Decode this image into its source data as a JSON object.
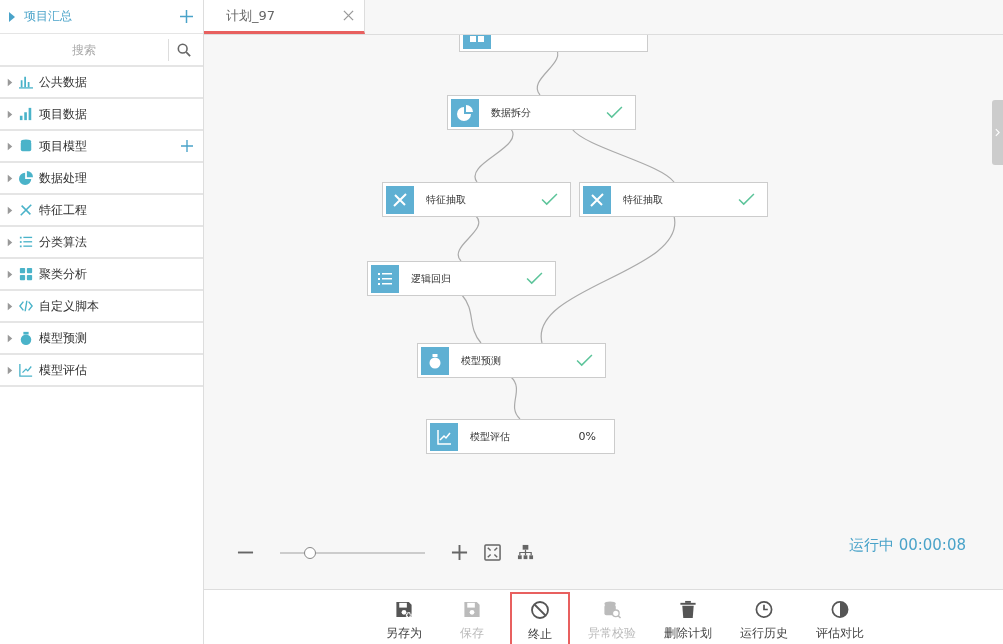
{
  "sidebar": {
    "header": {
      "label": "项目汇总",
      "expanded": false
    },
    "search": {
      "placeholder": "搜索"
    },
    "items": [
      {
        "label": "公共数据",
        "kind": "bars",
        "addable": false
      },
      {
        "label": "项目数据",
        "kind": "signal",
        "addable": false
      },
      {
        "label": "项目模型",
        "kind": "database",
        "addable": true
      },
      {
        "label": "数据处理",
        "kind": "pie",
        "addable": false
      },
      {
        "label": "特征工程",
        "kind": "tools",
        "addable": false
      },
      {
        "label": "分类算法",
        "kind": "list",
        "addable": false
      },
      {
        "label": "聚类分析",
        "kind": "grid",
        "addable": false
      },
      {
        "label": "自定义脚本",
        "kind": "code",
        "addable": false
      },
      {
        "label": "模型预测",
        "kind": "flask",
        "addable": false
      },
      {
        "label": "模型评估",
        "kind": "chart",
        "addable": false
      }
    ]
  },
  "tabs": [
    {
      "label": "计划_97",
      "selected": true
    }
  ],
  "flow": {
    "nodes": [
      {
        "kind": "grid"
      },
      {
        "label": "数据拆分",
        "kind": "pie",
        "done": true
      },
      {
        "label": "特征抽取",
        "kind": "tools",
        "done": true
      },
      {
        "label": "特征抽取",
        "kind": "tools",
        "done": true
      },
      {
        "label": "逻辑回归",
        "kind": "list",
        "done": true
      },
      {
        "label": "模型预测",
        "kind": "flask",
        "done": true
      },
      {
        "label": "模型评估",
        "kind": "chart",
        "done": false,
        "progress": "0%"
      }
    ],
    "zoom": {
      "level": 0.19
    },
    "run_status": "运行中 00:00:08"
  },
  "toolbar": [
    {
      "label": "另存为",
      "kind": "saveas",
      "disabled": false,
      "highlighted": false
    },
    {
      "label": "保存",
      "kind": "save",
      "disabled": true,
      "highlighted": false
    },
    {
      "label": "终止",
      "kind": "stop",
      "disabled": false,
      "highlighted": true
    },
    {
      "label": "异常校验",
      "kind": "check",
      "disabled": true,
      "highlighted": false
    },
    {
      "label": "删除计划",
      "kind": "trash",
      "disabled": false,
      "highlighted": false
    },
    {
      "label": "运行历史",
      "kind": "clock",
      "disabled": false,
      "highlighted": false
    },
    {
      "label": "评估对比",
      "kind": "contrast",
      "disabled": false,
      "highlighted": false
    }
  ]
}
